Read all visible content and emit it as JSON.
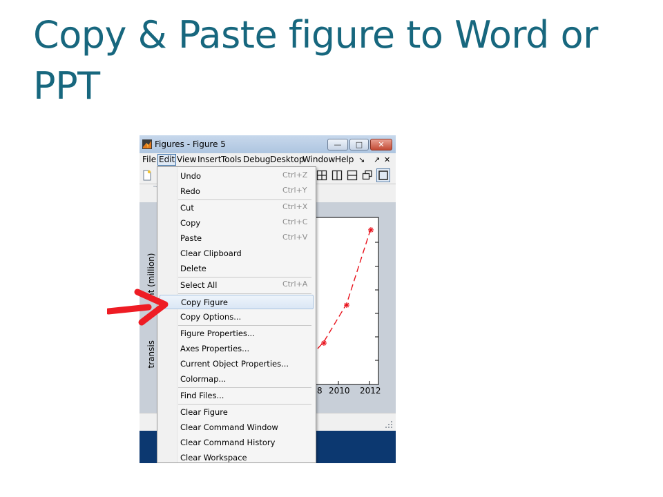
{
  "slide": {
    "title": "Copy & Paste figure to Word or PPT"
  },
  "window": {
    "title": "Figures - Figure 5",
    "controls": {
      "minimize": "—",
      "maximize": "□",
      "close": "✕"
    }
  },
  "menubar": {
    "items": [
      "File",
      "Edit",
      "View",
      "Insert",
      "Tools",
      "Debug",
      "Desktop",
      "Window",
      "Help"
    ],
    "active": "Edit",
    "dock_glyph": "↘",
    "undock_glyph": "↗",
    "close_glyph": "✕"
  },
  "figure": {
    "ylabel": "transis                nt (million)",
    "xticks": [
      "8",
      "2010",
      "2012"
    ]
  },
  "edit_menu": {
    "groups": [
      [
        {
          "label": "Undo",
          "shortcut": "Ctrl+Z"
        },
        {
          "label": "Redo",
          "shortcut": "Ctrl+Y"
        }
      ],
      [
        {
          "label": "Cut",
          "shortcut": "Ctrl+X"
        },
        {
          "label": "Copy",
          "shortcut": "Ctrl+C"
        },
        {
          "label": "Paste",
          "shortcut": "Ctrl+V"
        },
        {
          "label": "Clear Clipboard",
          "shortcut": ""
        },
        {
          "label": "Delete",
          "shortcut": ""
        }
      ],
      [
        {
          "label": "Select All",
          "shortcut": "Ctrl+A"
        }
      ],
      [
        {
          "label": "Copy Figure",
          "shortcut": "",
          "highlighted": true
        },
        {
          "label": "Copy Options...",
          "shortcut": ""
        }
      ],
      [
        {
          "label": "Figure Properties...",
          "shortcut": ""
        },
        {
          "label": "Axes Properties...",
          "shortcut": ""
        },
        {
          "label": "Current Object Properties...",
          "shortcut": ""
        },
        {
          "label": "Colormap...",
          "shortcut": ""
        }
      ],
      [
        {
          "label": "Find Files...",
          "shortcut": ""
        }
      ],
      [
        {
          "label": "Clear Figure",
          "shortcut": ""
        },
        {
          "label": "Clear Command Window",
          "shortcut": ""
        },
        {
          "label": "Clear Command History",
          "shortcut": ""
        },
        {
          "label": "Clear Workspace",
          "shortcut": ""
        }
      ]
    ]
  },
  "colors": {
    "title": "#17677e",
    "arrow": "#ee1c24",
    "plot_line": "#e8101a",
    "taskbar": "#0c3870"
  }
}
